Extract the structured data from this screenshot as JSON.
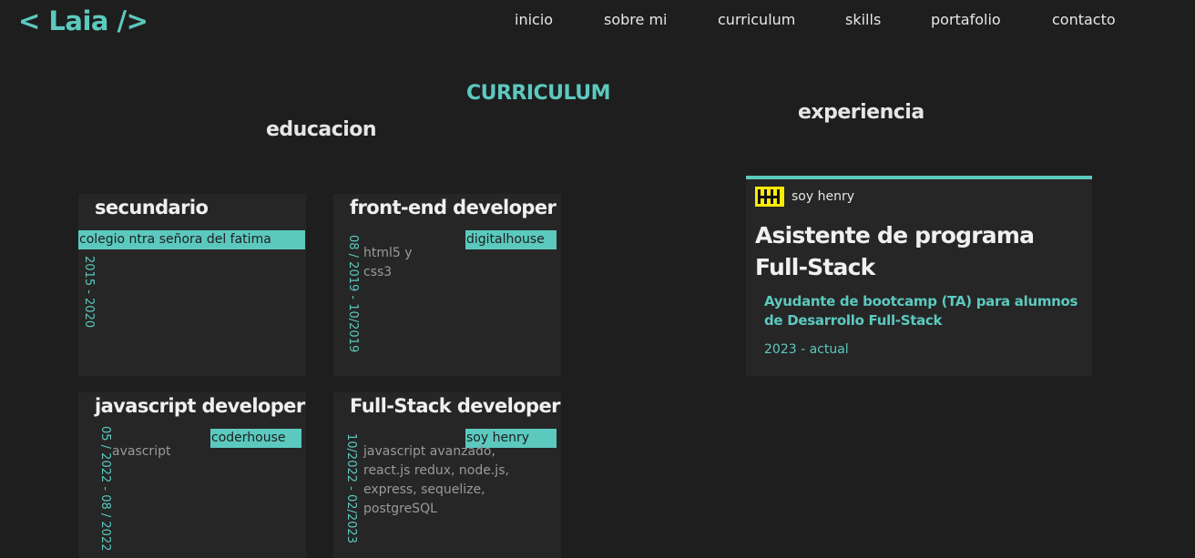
{
  "header": {
    "logo": "< Laia />",
    "nav": [
      "inicio",
      "sobre mi",
      "curriculum",
      "skills",
      "portafolio",
      "contacto"
    ]
  },
  "section_title": "CURRICULUM",
  "education": {
    "title": "educacion",
    "cards": [
      {
        "title": "secundario",
        "institution": "colegio ntra señora del fatima",
        "dates": "2015 - 2020",
        "description": ""
      },
      {
        "title": "front-end developer",
        "institution": "digitalhouse",
        "dates": "08 / 2019 - 10/2019",
        "description": "html5 y css3"
      },
      {
        "title": "javascript developer",
        "institution": "coderhouse",
        "dates": "05 / 2022 - 08 / 2022",
        "description": "avascript"
      },
      {
        "title": "Full-Stack developer",
        "institution": "soy henry",
        "dates": "10/2022 - 02/2023",
        "description": "javascript avanzado, react.js redux, node.js, express, sequelize, postgreSQL"
      }
    ]
  },
  "experience": {
    "title": "experiencia",
    "card": {
      "company": "soy henry",
      "logo_icon": "henry-logo-icon",
      "role": "Asistente de programa Full-Stack",
      "description": "Ayudante de bootcamp (TA) para alumnos de Desarrollo Full-Stack",
      "period": "2023 - actual"
    }
  },
  "colors": {
    "background": "#1e1e1e",
    "card": "#262626",
    "accent": "#5cc9bf",
    "logo_yellow": "#ffeb00"
  }
}
